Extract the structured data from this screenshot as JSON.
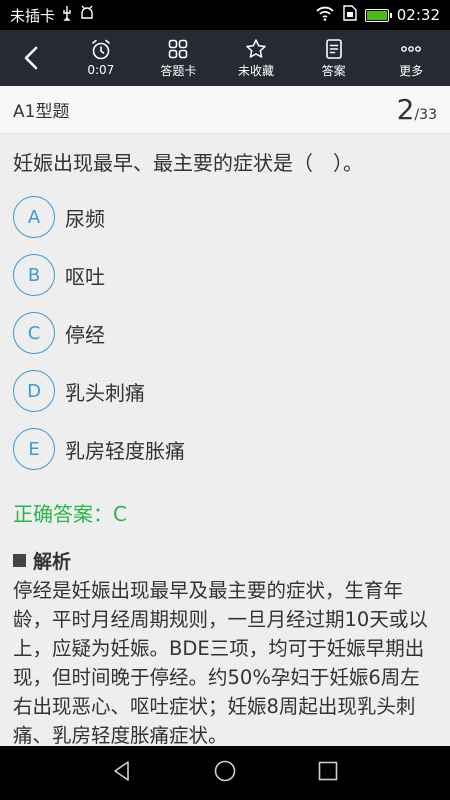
{
  "status_bar": {
    "carrier": "未插卡",
    "time": "02:32"
  },
  "toolbar": {
    "items": [
      {
        "label": "0:07",
        "icon": "alarm-clock-icon"
      },
      {
        "label": "答题卡",
        "icon": "grid-icon"
      },
      {
        "label": "未收藏",
        "icon": "star-outline-icon"
      },
      {
        "label": "答案",
        "icon": "document-icon"
      },
      {
        "label": "更多",
        "icon": "more-dots-icon"
      }
    ]
  },
  "question": {
    "type": "A1型题",
    "current": "2",
    "separator": "/",
    "total": "33",
    "stem": "妊娠出现最早、最主要的症状是（　）。",
    "options": [
      {
        "letter": "A",
        "text": "尿频"
      },
      {
        "letter": "B",
        "text": "呕吐"
      },
      {
        "letter": "C",
        "text": "停经"
      },
      {
        "letter": "D",
        "text": "乳头刺痛"
      },
      {
        "letter": "E",
        "text": "乳房轻度胀痛"
      }
    ],
    "answer": "正确答案：C",
    "analysis_title": "解析",
    "analysis_text": "停经是妊娠出现最早及最主要的症状，生育年龄，平时月经周期规则，一旦月经过期10天或以上，应疑为妊娠。BDE三项，均可于妊娠早期出现，但时间晚于停经。约50%孕妇于妊娠6周左右出现恶心、呕吐症状；妊娠8周起出现乳头刺痛、乳房轻度胀痛症状。"
  },
  "colors": {
    "toolbar_bg": "#262a33",
    "option_blue": "#3a9bd8",
    "answer_green": "#28b64a"
  }
}
